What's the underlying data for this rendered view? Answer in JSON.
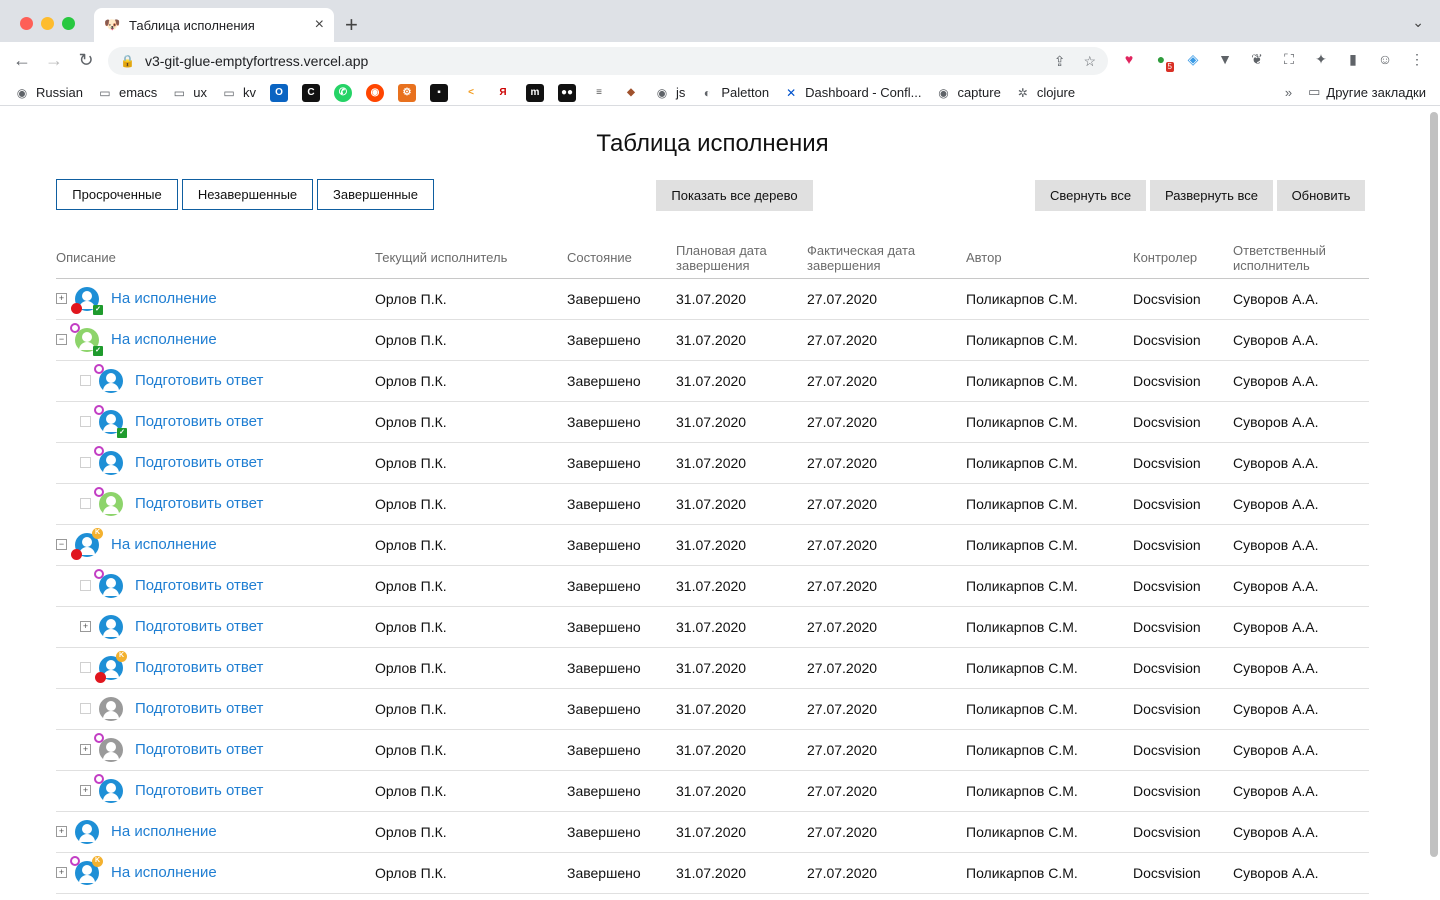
{
  "browser": {
    "tab_title": "Таблица исполнения",
    "url": "v3-git-glue-emptyfortress.vercel.app",
    "bookmarks": [
      "Russian",
      "emacs",
      "ux",
      "kv",
      "js",
      "Paletton",
      "Dashboard - Confl...",
      "capture",
      "clojure"
    ],
    "other_bookmarks": "Другие закладки",
    "ext_badge": "5"
  },
  "page": {
    "title": "Таблица исполнения",
    "filters": {
      "overdue": "Просроченные",
      "unfinished": "Незавершенные",
      "finished": "Завершенные"
    },
    "show_tree": "Показать все дерево",
    "collapse_all": "Свернуть все",
    "expand_all": "Развернуть все",
    "refresh": "Обновить"
  },
  "table": {
    "headers": {
      "desc": "Описание",
      "current": "Текущий исполнитель",
      "state": "Состояние",
      "plan": "Плановая дата завершения",
      "fact": "Фактическая дата завершения",
      "author": "Автор",
      "controller": "Контролер",
      "resp": "Ответственный исполнитель"
    },
    "rows": [
      {
        "level": 0,
        "toggle": "+",
        "avatar": "blue",
        "badges": [
          "red",
          "check"
        ],
        "desc": "На исполнение",
        "current": "Орлов П.К.",
        "state": "Завершено",
        "plan": "31.07.2020",
        "fact": "27.07.2020",
        "author": "Поликарпов С.М.",
        "controller": "Docsvision",
        "resp": "Суворов А.А."
      },
      {
        "level": 0,
        "toggle": "−",
        "avatar": "green",
        "badges": [
          "purple",
          "check"
        ],
        "desc": "На исполнение",
        "current": "Орлов П.К.",
        "state": "Завершено",
        "plan": "31.07.2020",
        "fact": "27.07.2020",
        "author": "Поликарпов С.М.",
        "controller": "Docsvision",
        "resp": "Суворов А.А."
      },
      {
        "level": 1,
        "toggle": "",
        "avatar": "blue",
        "badges": [
          "purple"
        ],
        "desc": "Подготовить ответ",
        "current": "Орлов П.К.",
        "state": "Завершено",
        "plan": "31.07.2020",
        "fact": "27.07.2020",
        "author": "Поликарпов С.М.",
        "controller": "Docsvision",
        "resp": "Суворов А.А."
      },
      {
        "level": 1,
        "toggle": "",
        "avatar": "blue",
        "badges": [
          "purple",
          "check"
        ],
        "desc": "Подготовить ответ",
        "current": "Орлов П.К.",
        "state": "Завершено",
        "plan": "31.07.2020",
        "fact": "27.07.2020",
        "author": "Поликарпов С.М.",
        "controller": "Docsvision",
        "resp": "Суворов А.А."
      },
      {
        "level": 1,
        "toggle": "",
        "avatar": "blue",
        "badges": [
          "purple"
        ],
        "desc": "Подготовить ответ",
        "current": "Орлов П.К.",
        "state": "Завершено",
        "plan": "31.07.2020",
        "fact": "27.07.2020",
        "author": "Поликарпов С.М.",
        "controller": "Docsvision",
        "resp": "Суворов А.А."
      },
      {
        "level": 1,
        "toggle": "",
        "avatar": "green",
        "badges": [
          "purple"
        ],
        "desc": "Подготовить ответ",
        "current": "Орлов П.К.",
        "state": "Завершено",
        "plan": "31.07.2020",
        "fact": "27.07.2020",
        "author": "Поликарпов С.М.",
        "controller": "Docsvision",
        "resp": "Суворов А.А."
      },
      {
        "level": 0,
        "toggle": "−",
        "avatar": "blue",
        "badges": [
          "red",
          "orange"
        ],
        "desc": "На исполнение",
        "current": "Орлов П.К.",
        "state": "Завершено",
        "plan": "31.07.2020",
        "fact": "27.07.2020",
        "author": "Поликарпов С.М.",
        "controller": "Docsvision",
        "resp": "Суворов А.А."
      },
      {
        "level": 1,
        "toggle": "",
        "avatar": "blue",
        "badges": [
          "purple"
        ],
        "desc": "Подготовить ответ",
        "current": "Орлов П.К.",
        "state": "Завершено",
        "plan": "31.07.2020",
        "fact": "27.07.2020",
        "author": "Поликарпов С.М.",
        "controller": "Docsvision",
        "resp": "Суворов А.А."
      },
      {
        "level": 1,
        "toggle": "+",
        "avatar": "blue",
        "badges": [],
        "desc": "Подготовить ответ",
        "current": "Орлов П.К.",
        "state": "Завершено",
        "plan": "31.07.2020",
        "fact": "27.07.2020",
        "author": "Поликарпов С.М.",
        "controller": "Docsvision",
        "resp": "Суворов А.А."
      },
      {
        "level": 1,
        "toggle": "",
        "avatar": "blue",
        "badges": [
          "red",
          "orange"
        ],
        "desc": "Подготовить ответ",
        "current": "Орлов П.К.",
        "state": "Завершено",
        "plan": "31.07.2020",
        "fact": "27.07.2020",
        "author": "Поликарпов С.М.",
        "controller": "Docsvision",
        "resp": "Суворов А.А."
      },
      {
        "level": 1,
        "toggle": "",
        "avatar": "gray",
        "badges": [],
        "desc": "Подготовить ответ",
        "current": "Орлов П.К.",
        "state": "Завершено",
        "plan": "31.07.2020",
        "fact": "27.07.2020",
        "author": "Поликарпов С.М.",
        "controller": "Docsvision",
        "resp": "Суворов А.А."
      },
      {
        "level": 1,
        "toggle": "+",
        "avatar": "gray",
        "badges": [
          "purple"
        ],
        "desc": "Подготовить ответ",
        "current": "Орлов П.К.",
        "state": "Завершено",
        "plan": "31.07.2020",
        "fact": "27.07.2020",
        "author": "Поликарпов С.М.",
        "controller": "Docsvision",
        "resp": "Суворов А.А."
      },
      {
        "level": 1,
        "toggle": "+",
        "avatar": "blue",
        "badges": [
          "purple"
        ],
        "desc": "Подготовить ответ",
        "current": "Орлов П.К.",
        "state": "Завершено",
        "plan": "31.07.2020",
        "fact": "27.07.2020",
        "author": "Поликарпов С.М.",
        "controller": "Docsvision",
        "resp": "Суворов А.А."
      },
      {
        "level": 0,
        "toggle": "+",
        "avatar": "blue",
        "badges": [],
        "desc": "На исполнение",
        "current": "Орлов П.К.",
        "state": "Завершено",
        "plan": "31.07.2020",
        "fact": "27.07.2020",
        "author": "Поликарпов С.М.",
        "controller": "Docsvision",
        "resp": "Суворов А.А."
      },
      {
        "level": 0,
        "toggle": "+",
        "avatar": "blue",
        "badges": [
          "purple",
          "orange"
        ],
        "desc": "На исполнение",
        "current": "Орлов П.К.",
        "state": "Завершено",
        "plan": "31.07.2020",
        "fact": "27.07.2020",
        "author": "Поликарпов С.М.",
        "controller": "Docsvision",
        "resp": "Суворов А.А."
      }
    ]
  }
}
